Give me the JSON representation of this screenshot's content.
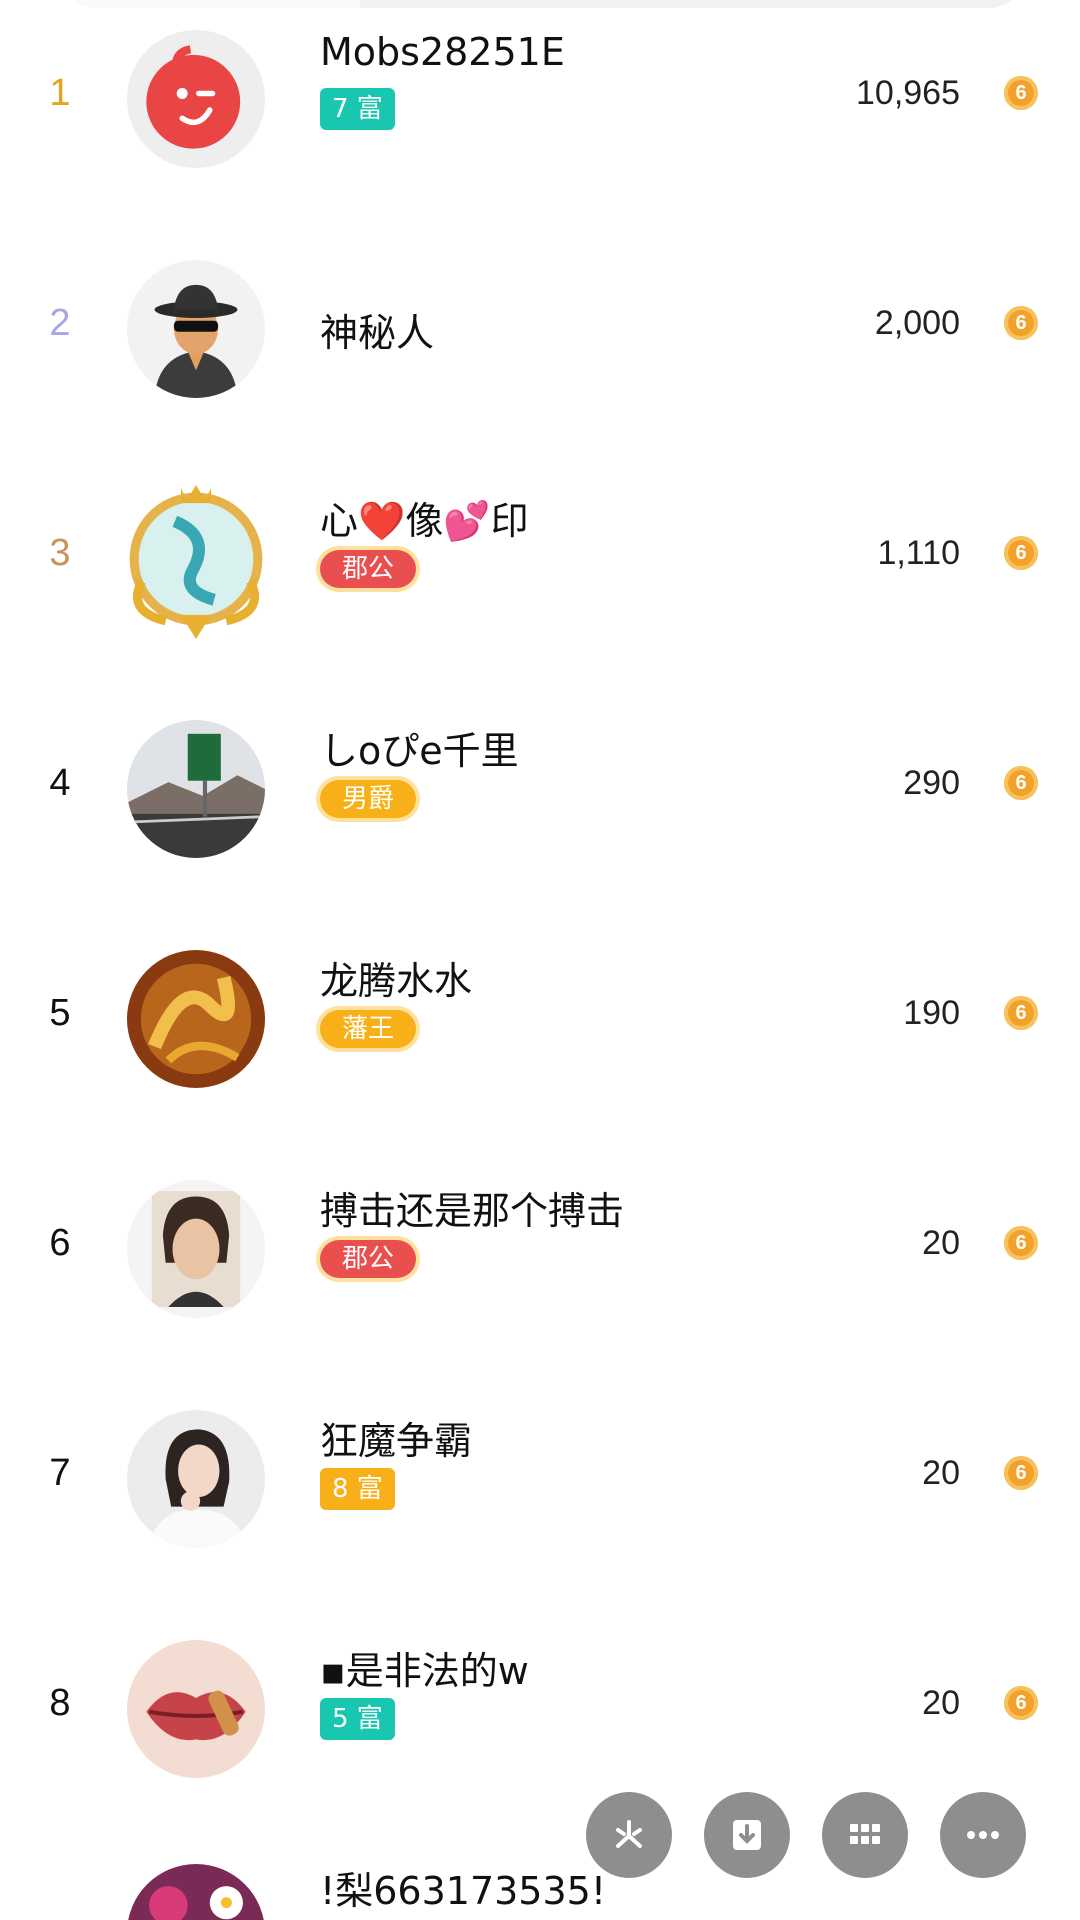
{
  "colors": {
    "rank1": "#e3a51c",
    "rank2": "#a9a6e6",
    "rank3": "#c8935a",
    "rank_default": "#111111",
    "badge_teal": "#19c6b0",
    "badge_orange": "#f7b018",
    "badge_red": "#ea4f4f",
    "coin": "#f2a12a",
    "fab": "#8e8e8e"
  },
  "leaderboard": {
    "rows": [
      {
        "rank": "1",
        "name": "Mobs28251E",
        "badge": "7 富",
        "badge_kind": "teal",
        "score": "10,965",
        "avatar_icon": "wink-face-icon"
      },
      {
        "rank": "2",
        "name": "神秘人",
        "badge": "",
        "badge_kind": "",
        "score": "2,000",
        "avatar_icon": "spy-icon"
      },
      {
        "rank": "3",
        "name": "心❤️像💕印",
        "badge": "郡公",
        "badge_kind": "red-ornate",
        "score": "1,110",
        "avatar_icon": "dragon-frame-icon"
      },
      {
        "rank": "4",
        "name": "しoぴe千里",
        "badge": "男爵",
        "badge_kind": "orange-ornate",
        "score": "290",
        "avatar_icon": "road-sign-photo"
      },
      {
        "rank": "5",
        "name": "龙腾水水",
        "badge": "藩王",
        "badge_kind": "orange-ornate",
        "score": "190",
        "avatar_icon": "golden-dragon-photo"
      },
      {
        "rank": "6",
        "name": "搏击还是那个搏击",
        "badge": "郡公",
        "badge_kind": "red-ornate",
        "score": "20",
        "avatar_icon": "portrait-photo"
      },
      {
        "rank": "7",
        "name": "狂魔争霸",
        "badge": "8 富",
        "badge_kind": "orange",
        "score": "20",
        "avatar_icon": "woman-photo"
      },
      {
        "rank": "8",
        "name": "▪是非法的w",
        "badge": "5 富",
        "badge_kind": "teal",
        "score": "20",
        "avatar_icon": "lips-photo"
      },
      {
        "rank": "",
        "name": "!梨663173535!",
        "badge": "",
        "badge_kind": "",
        "score": "",
        "avatar_icon": "flower-photo"
      }
    ],
    "coin_symbol": "6"
  },
  "floating_actions": [
    {
      "icon": "share-icon"
    },
    {
      "icon": "download-icon"
    },
    {
      "icon": "grid-icon"
    },
    {
      "icon": "more-icon"
    }
  ]
}
